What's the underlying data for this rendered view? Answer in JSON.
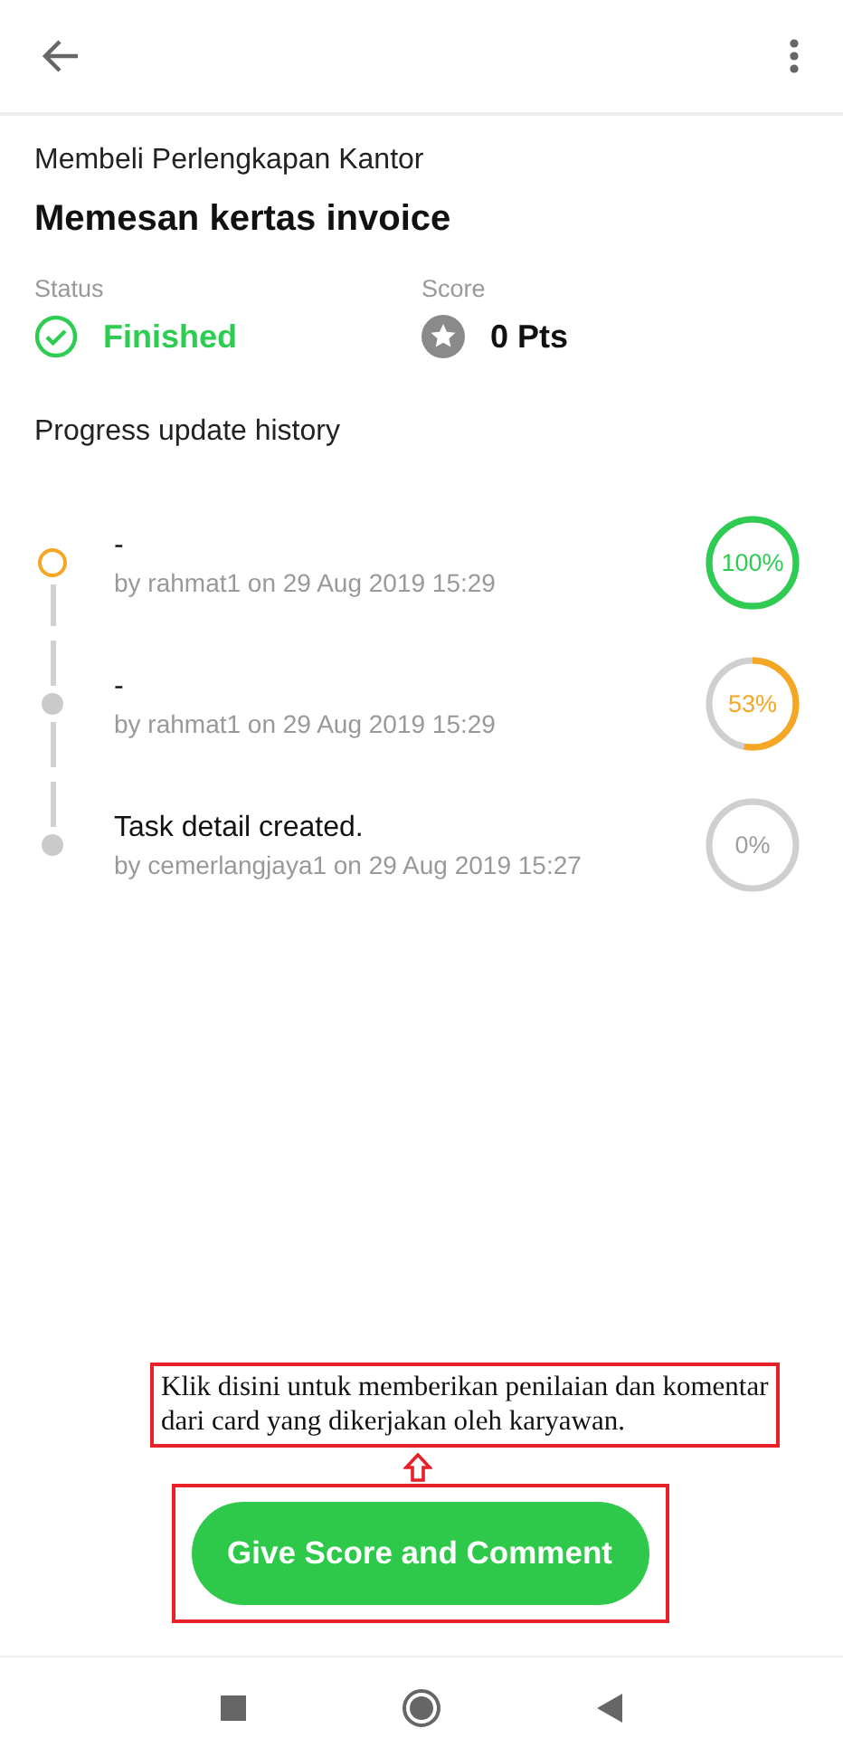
{
  "task": {
    "category": "Membeli Perlengkapan Kantor",
    "title": "Memesan kertas invoice"
  },
  "status": {
    "label": "Status",
    "value": "Finished"
  },
  "score": {
    "label": "Score",
    "value": "0 Pts"
  },
  "history": {
    "heading": "Progress update history",
    "items": [
      {
        "title": "-",
        "meta": "by rahmat1 on 29 Aug 2019 15:29",
        "percent": "100%",
        "level": 1,
        "color": "#2ecc52",
        "current": true
      },
      {
        "title": "-",
        "meta": "by rahmat1 on 29 Aug 2019 15:29",
        "percent": "53%",
        "level": 0.53,
        "color": "#f5a623",
        "current": false
      },
      {
        "title": "Task detail created.",
        "meta": "by cemerlangjaya1 on 29 Aug 2019 15:27",
        "percent": "0%",
        "level": 0,
        "color": "#9e9e9e",
        "current": false
      }
    ]
  },
  "annotation": "Klik disini untuk memberikan penilaian dan komentar dari card yang dikerjakan oleh karyawan.",
  "action_button": "Give Score and Comment"
}
